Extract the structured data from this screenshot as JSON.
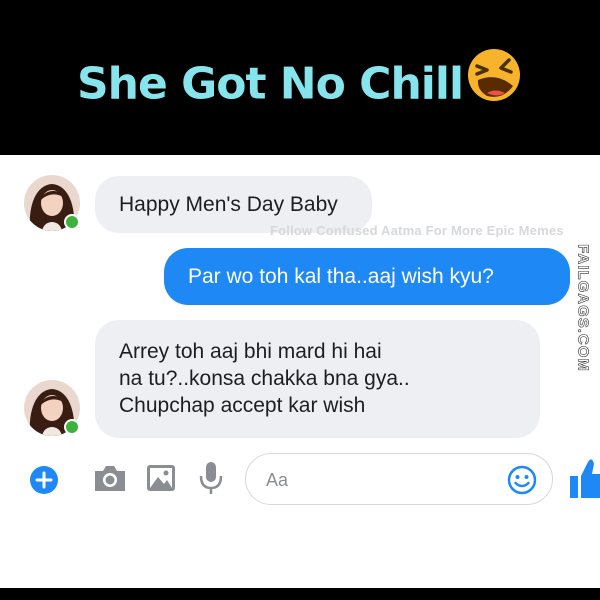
{
  "header": {
    "title": "She Got No Chill",
    "emoji": "laughing-emoji"
  },
  "messages": [
    {
      "from": "contact",
      "text_lines": [
        "Happy Men's Day Baby"
      ]
    },
    {
      "from": "me",
      "text_lines": [
        "Par wo toh kal tha..aaj wish kyu?"
      ]
    },
    {
      "from": "contact",
      "text_lines": [
        "Arrey toh aaj bhi mard hi hai",
        "na tu?..konsa chakka bna gya..",
        "Chupchap accept kar wish"
      ]
    }
  ],
  "watermarks": {
    "overlay": "Follow Confused Aatma For More Epic Memes",
    "side": "FAILGAGS.COM"
  },
  "composer": {
    "placeholder": "Aa",
    "icons": [
      "plus-icon",
      "camera-icon",
      "image-icon",
      "microphone-icon",
      "emoji-icon",
      "like-icon"
    ]
  },
  "colors": {
    "accent": "#1e88f5",
    "title": "#86e4ec",
    "online": "#3db33d",
    "incoming_bubble": "#eeeff2"
  }
}
